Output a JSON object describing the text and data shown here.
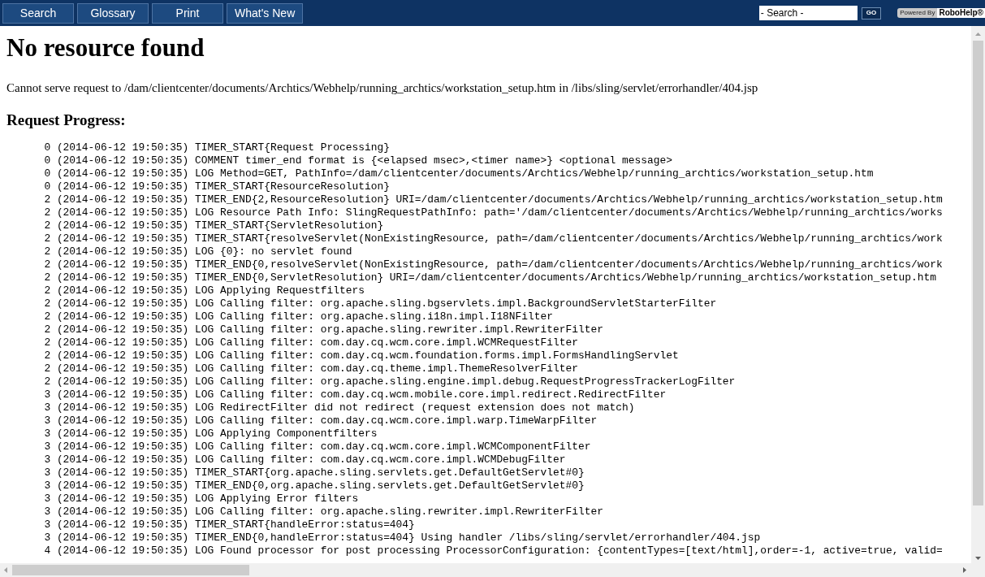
{
  "toolbar": {
    "buttons": [
      "Search",
      "Glossary",
      "Print",
      "What's New"
    ],
    "search": {
      "placeholder": "- Search -",
      "button": "GO"
    },
    "badge": {
      "prefix": "Powered By",
      "brand": "RoboHelp®"
    }
  },
  "page": {
    "title": "No resource found",
    "message": "Cannot serve request to /dam/clientcenter/documents/Archtics/Webhelp/running_archtics/workstation_setup.htm in /libs/sling/servlet/errorhandler/404.jsp",
    "section": "Request Progress:",
    "log": [
      "      0 (2014-06-12 19:50:35) TIMER_START{Request Processing}",
      "      0 (2014-06-12 19:50:35) COMMENT timer_end format is {<elapsed msec>,<timer name>} <optional message>",
      "      0 (2014-06-12 19:50:35) LOG Method=GET, PathInfo=/dam/clientcenter/documents/Archtics/Webhelp/running_archtics/workstation_setup.htm",
      "      0 (2014-06-12 19:50:35) TIMER_START{ResourceResolution}",
      "      2 (2014-06-12 19:50:35) TIMER_END{2,ResourceResolution} URI=/dam/clientcenter/documents/Archtics/Webhelp/running_archtics/workstation_setup.htm",
      "      2 (2014-06-12 19:50:35) LOG Resource Path Info: SlingRequestPathInfo: path='/dam/clientcenter/documents/Archtics/Webhelp/running_archtics/works",
      "      2 (2014-06-12 19:50:35) TIMER_START{ServletResolution}",
      "      2 (2014-06-12 19:50:35) TIMER_START{resolveServlet(NonExistingResource, path=/dam/clientcenter/documents/Archtics/Webhelp/running_archtics/work",
      "      2 (2014-06-12 19:50:35) LOG {0}: no servlet found",
      "      2 (2014-06-12 19:50:35) TIMER_END{0,resolveServlet(NonExistingResource, path=/dam/clientcenter/documents/Archtics/Webhelp/running_archtics/work",
      "      2 (2014-06-12 19:50:35) TIMER_END{0,ServletResolution} URI=/dam/clientcenter/documents/Archtics/Webhelp/running_archtics/workstation_setup.htm",
      "      2 (2014-06-12 19:50:35) LOG Applying Requestfilters",
      "      2 (2014-06-12 19:50:35) LOG Calling filter: org.apache.sling.bgservlets.impl.BackgroundServletStarterFilter",
      "      2 (2014-06-12 19:50:35) LOG Calling filter: org.apache.sling.i18n.impl.I18NFilter",
      "      2 (2014-06-12 19:50:35) LOG Calling filter: org.apache.sling.rewriter.impl.RewriterFilter",
      "      2 (2014-06-12 19:50:35) LOG Calling filter: com.day.cq.wcm.core.impl.WCMRequestFilter",
      "      2 (2014-06-12 19:50:35) LOG Calling filter: com.day.cq.wcm.foundation.forms.impl.FormsHandlingServlet",
      "      2 (2014-06-12 19:50:35) LOG Calling filter: com.day.cq.theme.impl.ThemeResolverFilter",
      "      2 (2014-06-12 19:50:35) LOG Calling filter: org.apache.sling.engine.impl.debug.RequestProgressTrackerLogFilter",
      "      3 (2014-06-12 19:50:35) LOG Calling filter: com.day.cq.wcm.mobile.core.impl.redirect.RedirectFilter",
      "      3 (2014-06-12 19:50:35) LOG RedirectFilter did not redirect (request extension does not match)",
      "      3 (2014-06-12 19:50:35) LOG Calling filter: com.day.cq.wcm.core.impl.warp.TimeWarpFilter",
      "      3 (2014-06-12 19:50:35) LOG Applying Componentfilters",
      "      3 (2014-06-12 19:50:35) LOG Calling filter: com.day.cq.wcm.core.impl.WCMComponentFilter",
      "      3 (2014-06-12 19:50:35) LOG Calling filter: com.day.cq.wcm.core.impl.WCMDebugFilter",
      "      3 (2014-06-12 19:50:35) TIMER_START{org.apache.sling.servlets.get.DefaultGetServlet#0}",
      "      3 (2014-06-12 19:50:35) TIMER_END{0,org.apache.sling.servlets.get.DefaultGetServlet#0}",
      "      3 (2014-06-12 19:50:35) LOG Applying Error filters",
      "      3 (2014-06-12 19:50:35) LOG Calling filter: org.apache.sling.rewriter.impl.RewriterFilter",
      "      3 (2014-06-12 19:50:35) TIMER_START{handleError:status=404}",
      "      3 (2014-06-12 19:50:35) TIMER_END{0,handleError:status=404} Using handler /libs/sling/servlet/errorhandler/404.jsp",
      "      4 (2014-06-12 19:50:35) LOG Found processor for post processing ProcessorConfiguration: {contentTypes=[text/html],order=-1, active=true, valid="
    ]
  }
}
